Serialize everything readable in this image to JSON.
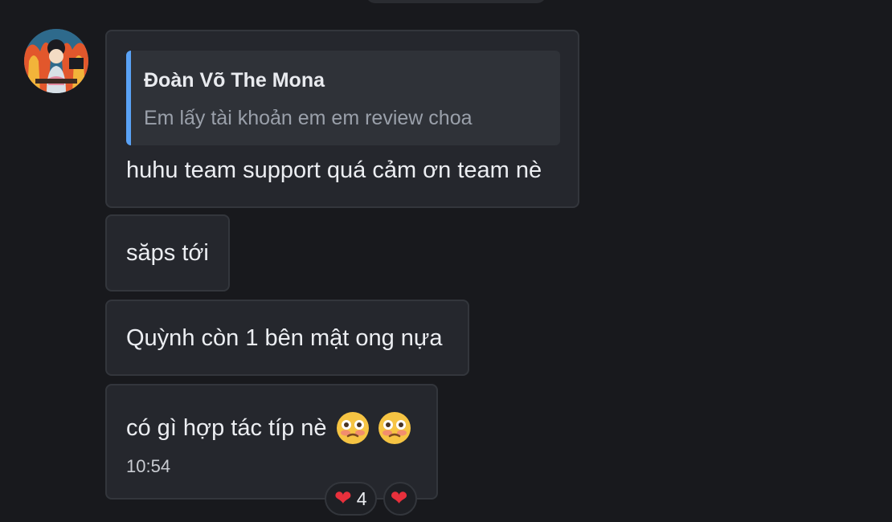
{
  "chat": {
    "messages": [
      {
        "reply_to": {
          "author": "Đoàn Võ The Mona",
          "text": "Em lấy tài khoản em em review choa"
        },
        "text": "huhu team support quá cảm ơn team nè"
      },
      {
        "text": "săps tới"
      },
      {
        "text": "Quỳnh còn 1 bên mật ong nựa"
      },
      {
        "text": "có gì hợp tác típ nè",
        "emojis": [
          "flushed-face-icon",
          "flushed-face-icon"
        ],
        "time": "10:54"
      }
    ],
    "reactions": [
      {
        "icon": "heart-icon",
        "glyph": "❤",
        "count": "4"
      },
      {
        "icon": "heart-icon",
        "glyph": "❤",
        "count": ""
      }
    ]
  },
  "colors": {
    "background": "#18191d",
    "bubble": "#25272d",
    "quote_bar": "#5aa2f5",
    "heart": "#e8303c"
  }
}
